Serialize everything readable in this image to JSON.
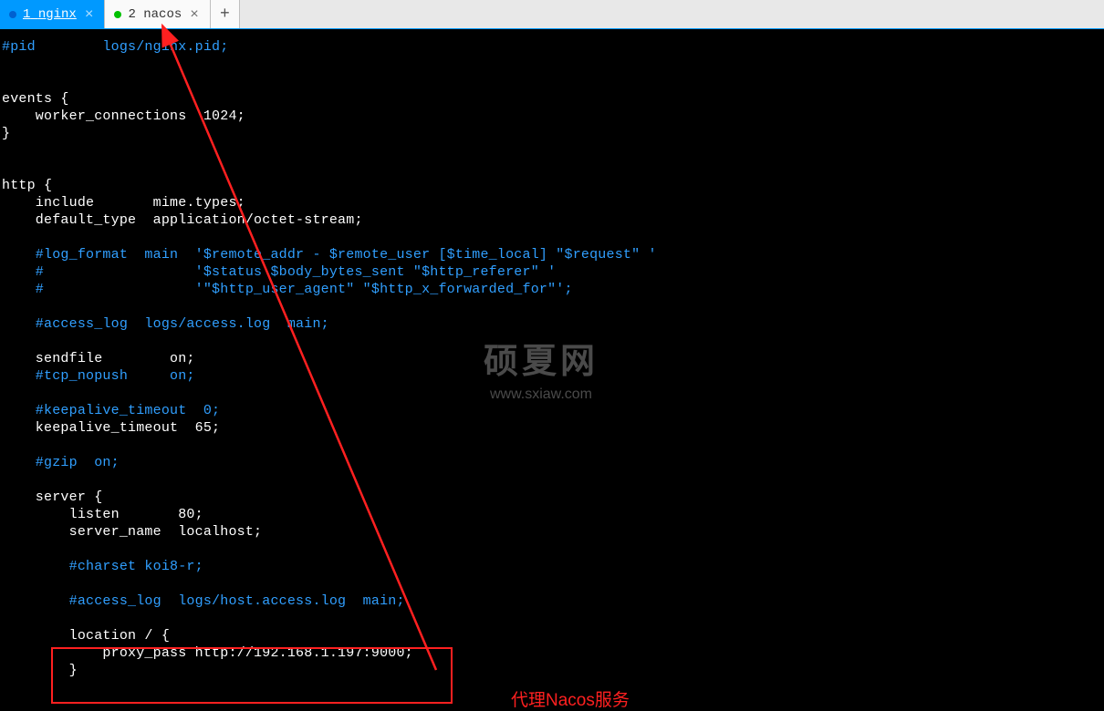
{
  "tabs": [
    {
      "index": "1",
      "title": "nginx",
      "dot": "blue",
      "active": true
    },
    {
      "index": "2",
      "title": "nacos",
      "dot": "green",
      "active": false
    }
  ],
  "watermark": {
    "title": "硕夏网",
    "url": "www.sxiaw.com"
  },
  "code": [
    {
      "cls": "blue",
      "text": "#pid        logs/nginx.pid;"
    },
    {
      "cls": "",
      "text": ""
    },
    {
      "cls": "",
      "text": ""
    },
    {
      "cls": "white",
      "text": "events {"
    },
    {
      "cls": "white",
      "text": "    worker_connections  1024;"
    },
    {
      "cls": "white",
      "text": "}"
    },
    {
      "cls": "",
      "text": ""
    },
    {
      "cls": "",
      "text": ""
    },
    {
      "cls": "white",
      "text": "http {"
    },
    {
      "cls": "white",
      "text": "    include       mime.types;"
    },
    {
      "cls": "white",
      "text": "    default_type  application/octet-stream;"
    },
    {
      "cls": "",
      "text": ""
    },
    {
      "cls": "blue",
      "text": "    #log_format  main  '$remote_addr - $remote_user [$time_local] \"$request\" '"
    },
    {
      "cls": "blue",
      "text": "    #                  '$status $body_bytes_sent \"$http_referer\" '"
    },
    {
      "cls": "blue",
      "text": "    #                  '\"$http_user_agent\" \"$http_x_forwarded_for\"';"
    },
    {
      "cls": "",
      "text": ""
    },
    {
      "cls": "blue",
      "text": "    #access_log  logs/access.log  main;"
    },
    {
      "cls": "",
      "text": ""
    },
    {
      "cls": "white",
      "text": "    sendfile        on;"
    },
    {
      "cls": "blue",
      "text": "    #tcp_nopush     on;"
    },
    {
      "cls": "",
      "text": ""
    },
    {
      "cls": "blue",
      "text": "    #keepalive_timeout  0;"
    },
    {
      "cls": "white",
      "text": "    keepalive_timeout  65;"
    },
    {
      "cls": "",
      "text": ""
    },
    {
      "cls": "blue",
      "text": "    #gzip  on;"
    },
    {
      "cls": "",
      "text": ""
    },
    {
      "cls": "white",
      "text": "    server {"
    },
    {
      "cls": "white",
      "text": "        listen       80;"
    },
    {
      "cls": "white",
      "text": "        server_name  localhost;"
    },
    {
      "cls": "",
      "text": ""
    },
    {
      "cls": "blue",
      "text": "        #charset koi8-r;"
    },
    {
      "cls": "",
      "text": ""
    },
    {
      "cls": "blue",
      "text": "        #access_log  logs/host.access.log  main;"
    },
    {
      "cls": "",
      "text": ""
    },
    {
      "cls": "white",
      "text": "        location / {"
    },
    {
      "cls": "white",
      "text": "            proxy_pass http://192.168.1.197:9000;"
    },
    {
      "cls": "white",
      "text": "        }"
    }
  ],
  "annotation": "代理Nacos服务"
}
